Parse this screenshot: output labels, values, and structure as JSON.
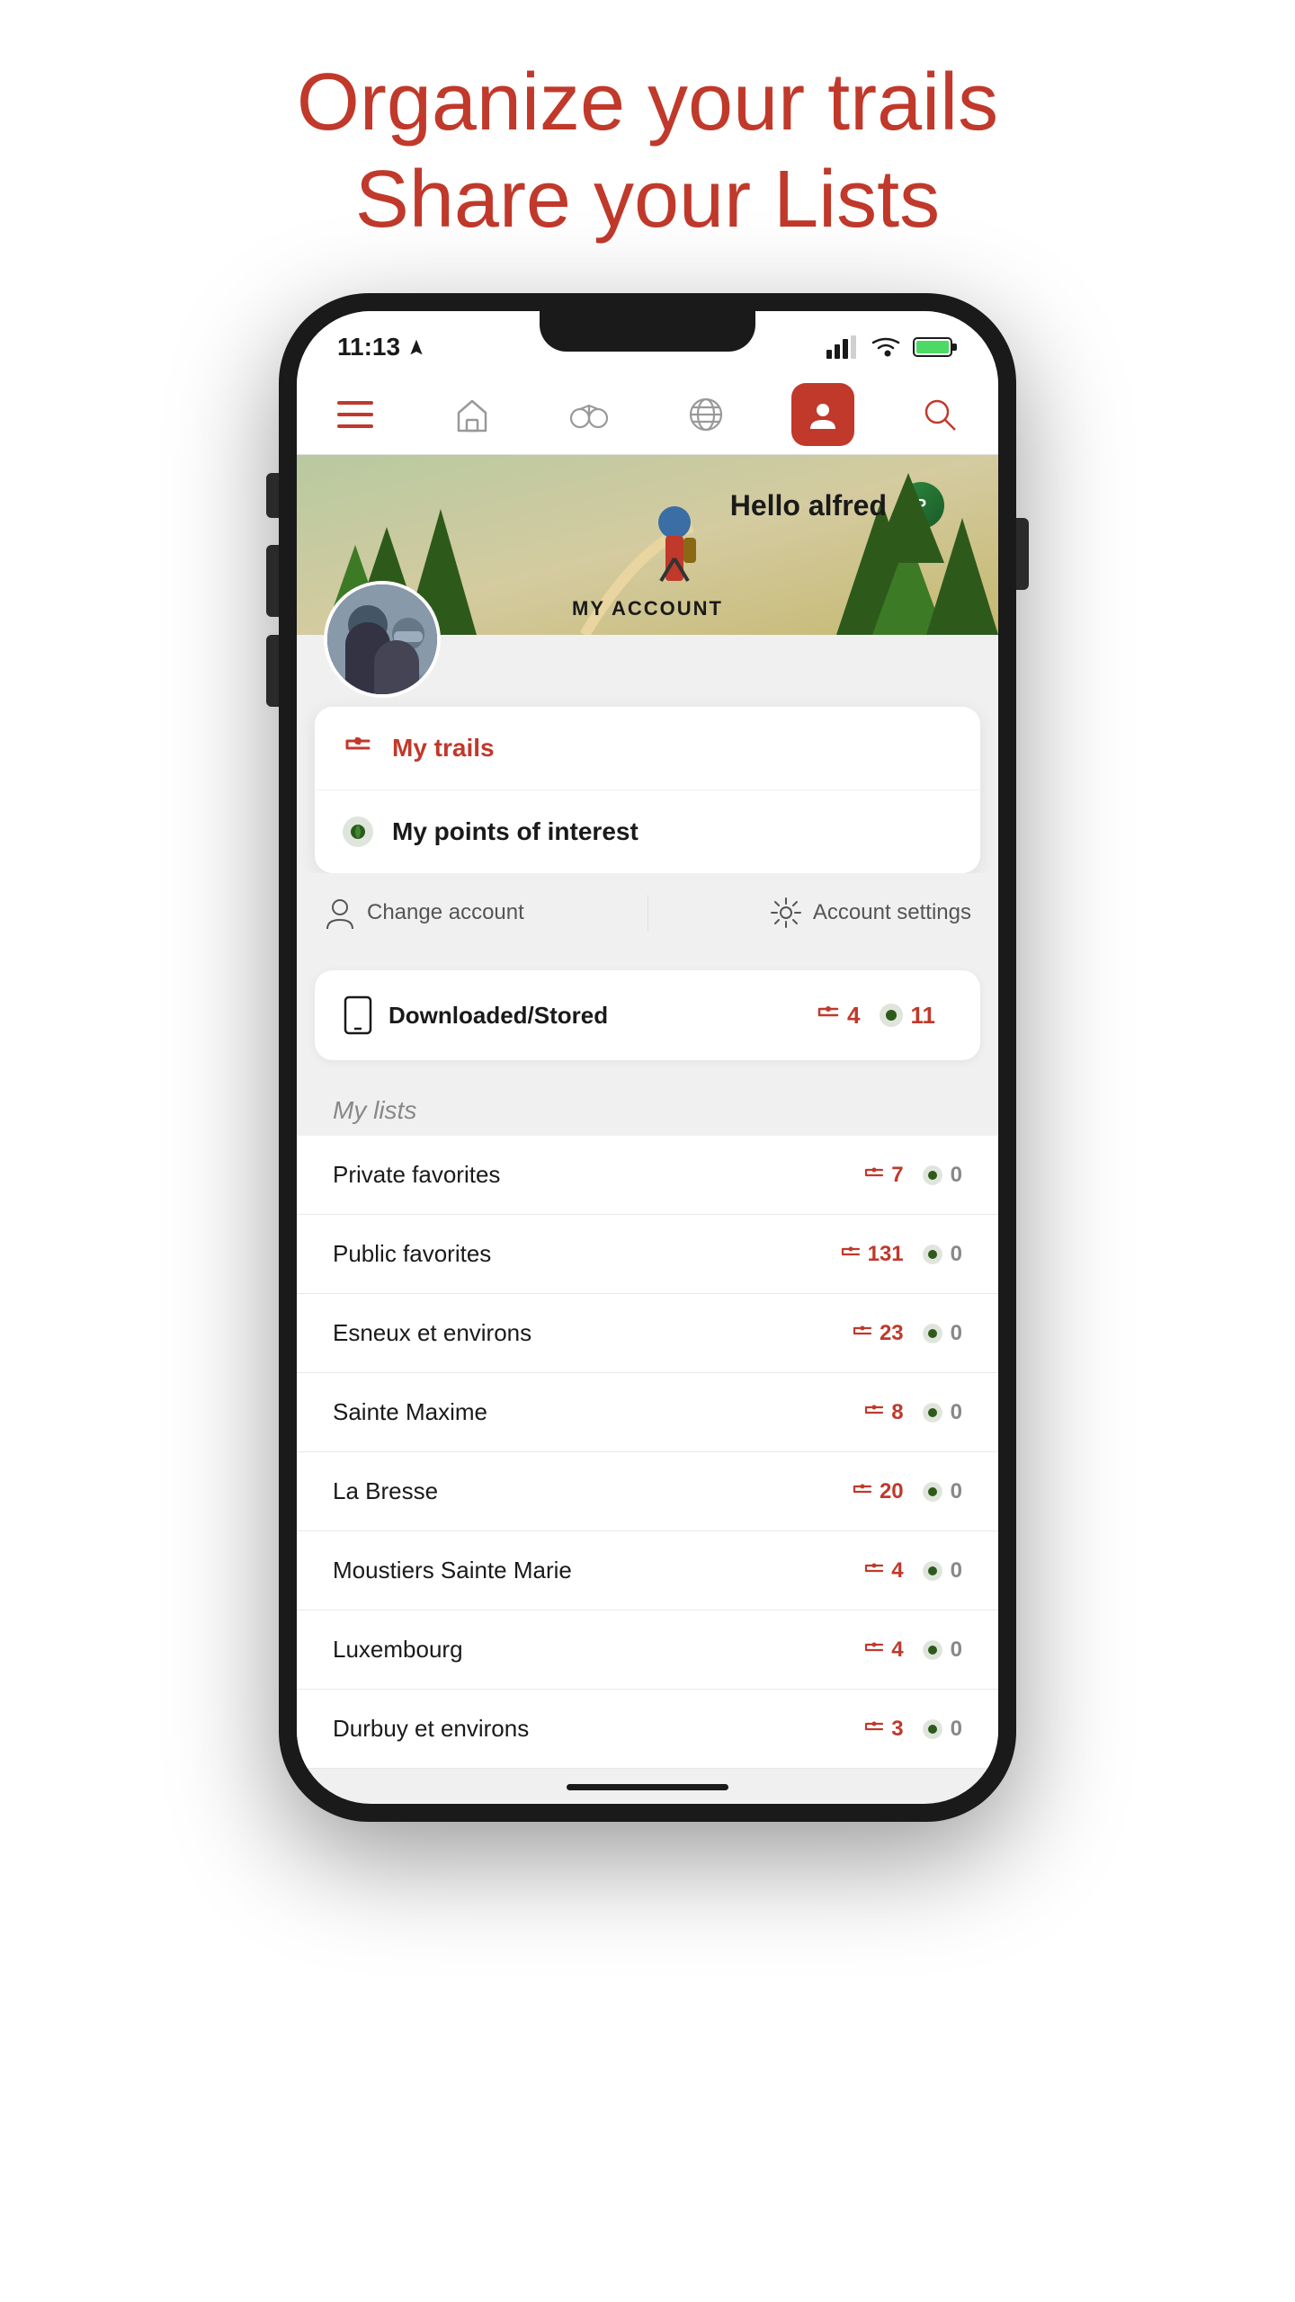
{
  "header": {
    "line1": "Organize your trails",
    "line2_prefix": "Share your ",
    "line2_highlight": "Lists"
  },
  "status_bar": {
    "time": "11:13",
    "location_arrow": true
  },
  "nav": {
    "items": [
      {
        "name": "menu",
        "label": "Menu"
      },
      {
        "name": "home",
        "label": "Home"
      },
      {
        "name": "explore",
        "label": "Explore"
      },
      {
        "name": "globe",
        "label": "Globe"
      },
      {
        "name": "profile",
        "label": "Profile",
        "active": true
      },
      {
        "name": "search",
        "label": "Search"
      }
    ]
  },
  "hero": {
    "greeting": "Hello alfred",
    "pro_badge": "P"
  },
  "account": {
    "section_label": "MY ACCOUNT",
    "my_trails_label": "My trails",
    "my_poi_label": "My points of interest",
    "change_account_label": "Change account",
    "account_settings_label": "Account settings"
  },
  "downloaded": {
    "label": "Downloaded/Stored",
    "trails_count": "4",
    "poi_count": "11"
  },
  "my_lists": {
    "section_label": "My lists",
    "items": [
      {
        "name": "Private favorites",
        "trails": "7",
        "poi": "0"
      },
      {
        "name": "Public favorites",
        "trails": "131",
        "poi": "0"
      },
      {
        "name": "Esneux et environs",
        "trails": "23",
        "poi": "0"
      },
      {
        "name": "Sainte Maxime",
        "trails": "8",
        "poi": "0"
      },
      {
        "name": "La Bresse",
        "trails": "20",
        "poi": "0"
      },
      {
        "name": "Moustiers Sainte Marie",
        "trails": "4",
        "poi": "0"
      },
      {
        "name": "Luxembourg",
        "trails": "4",
        "poi": "0"
      },
      {
        "name": "Durbuy et environs",
        "trails": "3",
        "poi": "0"
      }
    ]
  }
}
